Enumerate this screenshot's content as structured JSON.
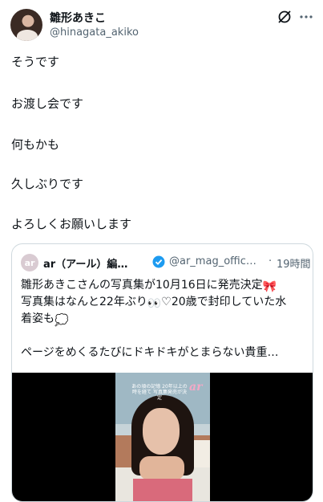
{
  "author": {
    "name": "雛形あきこ",
    "handle": "@hinagata_akiko",
    "avatar_icon": "profile-photo"
  },
  "header_actions": {
    "grok_icon": "grok-icon",
    "more_icon": "more-dots-icon"
  },
  "tweet": {
    "lines": [
      "そうです",
      "お渡し会です",
      "何もかも",
      "久しぶりです",
      "よろしくお願いします"
    ]
  },
  "quote": {
    "avatar_text": "ar",
    "name": "ar（アール）編…",
    "verified_icon": "verified-badge-icon",
    "handle": "@ar_mag_offic…",
    "dot": "·",
    "time": "19時間",
    "line1": "雛形あきこさんの写真集が10月16日に発売決定",
    "line2": "写真集はなんと22年ぶり",
    "line2b": "♡20歳で封印していた水",
    "line3": "着姿も",
    "line4": "ページをめくるたびにドキドキがとまらない貴重…",
    "emoji": {
      "ribbon": "🎀",
      "eyes": "👀",
      "thought": "💭"
    },
    "media": {
      "logo": "ar",
      "caption": "あの頃の記憶 20年以上の時を経て 写真集発売が決定"
    }
  },
  "colors": {
    "text": "#0f1419",
    "secondary": "#536471",
    "border": "#cfd9de",
    "verified": "#1d9bf0"
  }
}
